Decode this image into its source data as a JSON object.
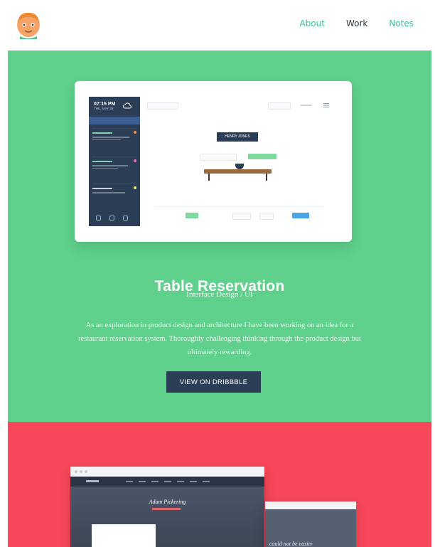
{
  "nav": {
    "about": "About",
    "work": "Work",
    "notes": "Notes"
  },
  "project": {
    "mock": {
      "time": "07:15 PM",
      "date": "THU, MAY 28",
      "name_tag": "HENRY JONES"
    },
    "title": "Table Reservation",
    "subtitle": "Interface Design / UI",
    "description": "As an exploration in product design and architecture I have been working on an idea for a restaurant reservation system. Thoroughly challenging thinking through the product design but ultimately rewarding.",
    "cta": "VIEW ON DRIBBBLE"
  },
  "project2": {
    "hero_name": "Adam Pickering",
    "side_text": "could not be easier"
  },
  "colors": {
    "green": "#5fd18c",
    "red": "#f8475a",
    "navy": "#2c3e56",
    "teal_nav": "#3fbf9e"
  }
}
